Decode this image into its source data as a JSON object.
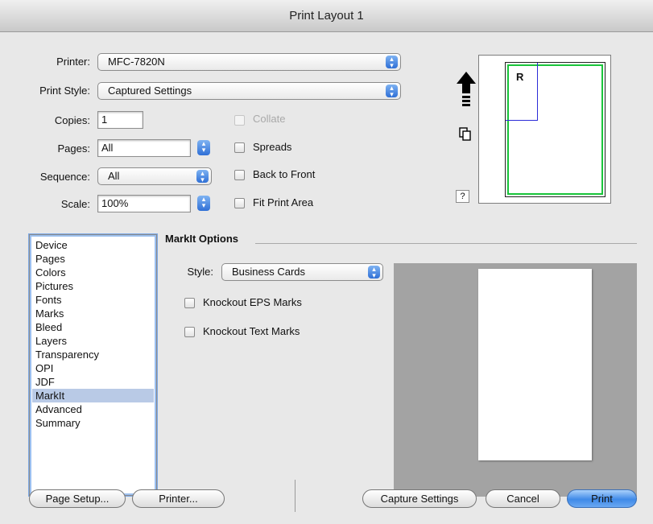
{
  "window": {
    "title": "Print Layout 1"
  },
  "form": {
    "printer_label": "Printer:",
    "printer_value": "MFC-7820N",
    "print_style_label": "Print Style:",
    "print_style_value": "Captured Settings",
    "copies_label": "Copies:",
    "copies_value": "1",
    "pages_label": "Pages:",
    "pages_value": "All",
    "sequence_label": "Sequence:",
    "sequence_value": "All",
    "scale_label": "Scale:",
    "scale_value": "100%"
  },
  "checkboxes": {
    "collate": {
      "label": "Collate",
      "checked": false,
      "enabled": false
    },
    "spreads": {
      "label": "Spreads",
      "checked": false
    },
    "back_to_front": {
      "label": "Back to Front",
      "checked": false
    },
    "fit_print_area": {
      "label": "Fit Print Area",
      "checked": false
    }
  },
  "preview": {
    "page_letter": "R",
    "help_label": "?"
  },
  "sidebar": {
    "items": [
      "Device",
      "Pages",
      "Colors",
      "Pictures",
      "Fonts",
      "Marks",
      "Bleed",
      "Layers",
      "Transparency",
      "OPI",
      "JDF",
      "MarkIt",
      "Advanced",
      "Summary"
    ],
    "selected": "MarkIt"
  },
  "markit": {
    "group_title": "MarkIt Options",
    "style_label": "Style:",
    "style_value": "Business Cards",
    "knockout_eps": {
      "label": "Knockout EPS Marks",
      "checked": false
    },
    "knockout_text": {
      "label": "Knockout Text Marks",
      "checked": false
    }
  },
  "buttons": {
    "page_setup": "Page Setup...",
    "printer": "Printer...",
    "capture_settings": "Capture Settings",
    "cancel": "Cancel",
    "print": "Print"
  },
  "colors": {
    "accent": "#3f8ae8",
    "printable_area": "#19c43a",
    "selection": "#b9cae6"
  }
}
